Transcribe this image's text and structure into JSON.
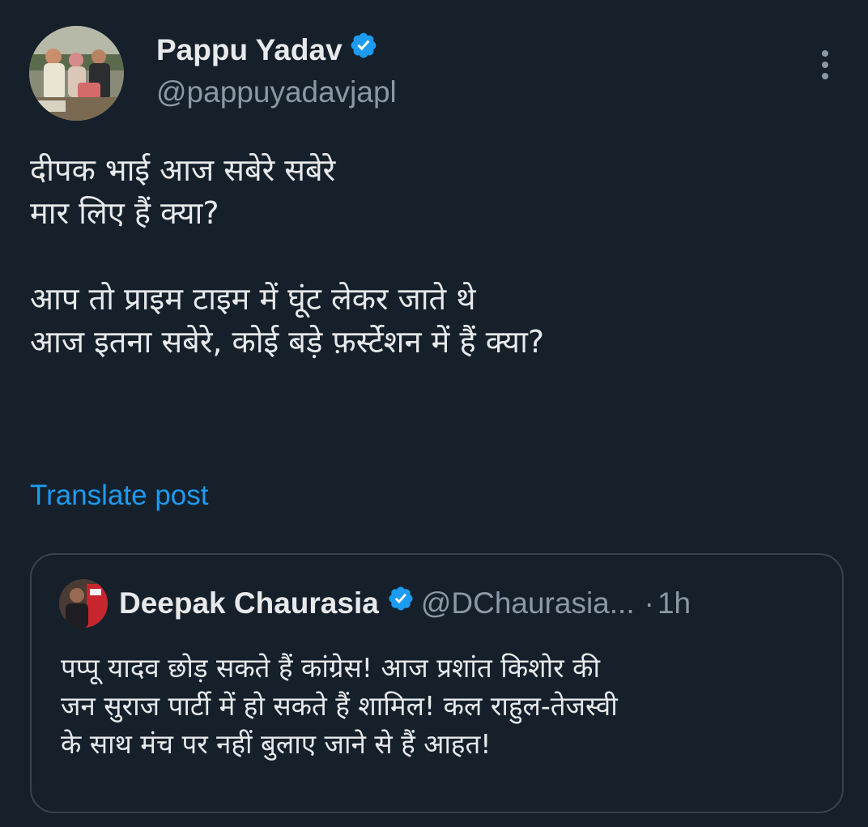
{
  "post": {
    "author_name": "Pappu Yadav",
    "author_handle": "@pappuyadavjapl",
    "verified": true,
    "text": "दीपक भाई आज सबेरे सबेरे\nमार लिए हैं क्या?\n\nआप तो प्राइम टाइम में घूंट लेकर जाते थे\nआज इतना सबेरे, कोई बड़े फ़र्स्टेशन में हैं क्या?",
    "translate_label": "Translate post"
  },
  "quoted_post": {
    "author_name": "Deepak Chaurasia",
    "author_handle": "@DChaurasia...",
    "verified": true,
    "separator": "·",
    "timestamp": "1h",
    "text": "पप्पू यादव छोड़ सकते हैं कांग्रेस! आज प्रशांत किशोर की\nजन सुराज पार्टी में हो सकते हैं शामिल! कल राहुल-तेजस्वी\nके साथ मंच पर नहीं बुलाए जाने से हैं आहत!"
  },
  "icons": {
    "verified": "verified-badge-icon",
    "more": "more-vertical-icon"
  },
  "colors": {
    "background": "#15202b",
    "text": "#e7e9ea",
    "secondary": "#8b98a5",
    "accent": "#1d9bf0",
    "border": "#38444d"
  }
}
